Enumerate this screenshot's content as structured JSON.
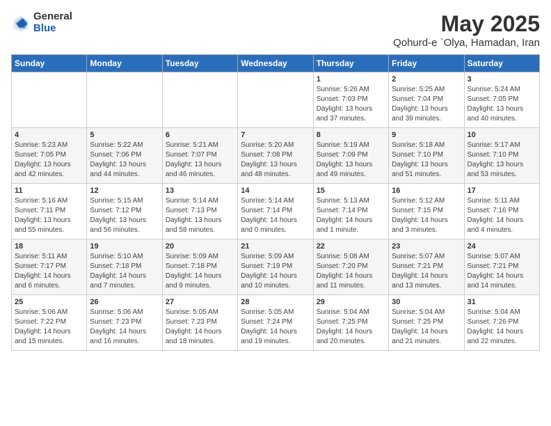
{
  "logo": {
    "general": "General",
    "blue": "Blue"
  },
  "title": "May 2025",
  "subtitle": "Qohurd-e `Olya, Hamadan, Iran",
  "days_header": [
    "Sunday",
    "Monday",
    "Tuesday",
    "Wednesday",
    "Thursday",
    "Friday",
    "Saturday"
  ],
  "weeks": [
    [
      {
        "num": "",
        "info": ""
      },
      {
        "num": "",
        "info": ""
      },
      {
        "num": "",
        "info": ""
      },
      {
        "num": "",
        "info": ""
      },
      {
        "num": "1",
        "info": "Sunrise: 5:26 AM\nSunset: 7:03 PM\nDaylight: 13 hours\nand 37 minutes."
      },
      {
        "num": "2",
        "info": "Sunrise: 5:25 AM\nSunset: 7:04 PM\nDaylight: 13 hours\nand 39 minutes."
      },
      {
        "num": "3",
        "info": "Sunrise: 5:24 AM\nSunset: 7:05 PM\nDaylight: 13 hours\nand 40 minutes."
      }
    ],
    [
      {
        "num": "4",
        "info": "Sunrise: 5:23 AM\nSunset: 7:05 PM\nDaylight: 13 hours\nand 42 minutes."
      },
      {
        "num": "5",
        "info": "Sunrise: 5:22 AM\nSunset: 7:06 PM\nDaylight: 13 hours\nand 44 minutes."
      },
      {
        "num": "6",
        "info": "Sunrise: 5:21 AM\nSunset: 7:07 PM\nDaylight: 13 hours\nand 46 minutes."
      },
      {
        "num": "7",
        "info": "Sunrise: 5:20 AM\nSunset: 7:08 PM\nDaylight: 13 hours\nand 48 minutes."
      },
      {
        "num": "8",
        "info": "Sunrise: 5:19 AM\nSunset: 7:09 PM\nDaylight: 13 hours\nand 49 minutes."
      },
      {
        "num": "9",
        "info": "Sunrise: 5:18 AM\nSunset: 7:10 PM\nDaylight: 13 hours\nand 51 minutes."
      },
      {
        "num": "10",
        "info": "Sunrise: 5:17 AM\nSunset: 7:10 PM\nDaylight: 13 hours\nand 53 minutes."
      }
    ],
    [
      {
        "num": "11",
        "info": "Sunrise: 5:16 AM\nSunset: 7:11 PM\nDaylight: 13 hours\nand 55 minutes."
      },
      {
        "num": "12",
        "info": "Sunrise: 5:15 AM\nSunset: 7:12 PM\nDaylight: 13 hours\nand 56 minutes."
      },
      {
        "num": "13",
        "info": "Sunrise: 5:14 AM\nSunset: 7:13 PM\nDaylight: 13 hours\nand 58 minutes."
      },
      {
        "num": "14",
        "info": "Sunrise: 5:14 AM\nSunset: 7:14 PM\nDaylight: 14 hours\nand 0 minutes."
      },
      {
        "num": "15",
        "info": "Sunrise: 5:13 AM\nSunset: 7:14 PM\nDaylight: 14 hours\nand 1 minute."
      },
      {
        "num": "16",
        "info": "Sunrise: 5:12 AM\nSunset: 7:15 PM\nDaylight: 14 hours\nand 3 minutes."
      },
      {
        "num": "17",
        "info": "Sunrise: 5:11 AM\nSunset: 7:16 PM\nDaylight: 14 hours\nand 4 minutes."
      }
    ],
    [
      {
        "num": "18",
        "info": "Sunrise: 5:11 AM\nSunset: 7:17 PM\nDaylight: 14 hours\nand 6 minutes."
      },
      {
        "num": "19",
        "info": "Sunrise: 5:10 AM\nSunset: 7:18 PM\nDaylight: 14 hours\nand 7 minutes."
      },
      {
        "num": "20",
        "info": "Sunrise: 5:09 AM\nSunset: 7:18 PM\nDaylight: 14 hours\nand 9 minutes."
      },
      {
        "num": "21",
        "info": "Sunrise: 5:09 AM\nSunset: 7:19 PM\nDaylight: 14 hours\nand 10 minutes."
      },
      {
        "num": "22",
        "info": "Sunrise: 5:08 AM\nSunset: 7:20 PM\nDaylight: 14 hours\nand 11 minutes."
      },
      {
        "num": "23",
        "info": "Sunrise: 5:07 AM\nSunset: 7:21 PM\nDaylight: 14 hours\nand 13 minutes."
      },
      {
        "num": "24",
        "info": "Sunrise: 5:07 AM\nSunset: 7:21 PM\nDaylight: 14 hours\nand 14 minutes."
      }
    ],
    [
      {
        "num": "25",
        "info": "Sunrise: 5:06 AM\nSunset: 7:22 PM\nDaylight: 14 hours\nand 15 minutes."
      },
      {
        "num": "26",
        "info": "Sunrise: 5:06 AM\nSunset: 7:23 PM\nDaylight: 14 hours\nand 16 minutes."
      },
      {
        "num": "27",
        "info": "Sunrise: 5:05 AM\nSunset: 7:23 PM\nDaylight: 14 hours\nand 18 minutes."
      },
      {
        "num": "28",
        "info": "Sunrise: 5:05 AM\nSunset: 7:24 PM\nDaylight: 14 hours\nand 19 minutes."
      },
      {
        "num": "29",
        "info": "Sunrise: 5:04 AM\nSunset: 7:25 PM\nDaylight: 14 hours\nand 20 minutes."
      },
      {
        "num": "30",
        "info": "Sunrise: 5:04 AM\nSunset: 7:25 PM\nDaylight: 14 hours\nand 21 minutes."
      },
      {
        "num": "31",
        "info": "Sunrise: 5:04 AM\nSunset: 7:26 PM\nDaylight: 14 hours\nand 22 minutes."
      }
    ]
  ]
}
